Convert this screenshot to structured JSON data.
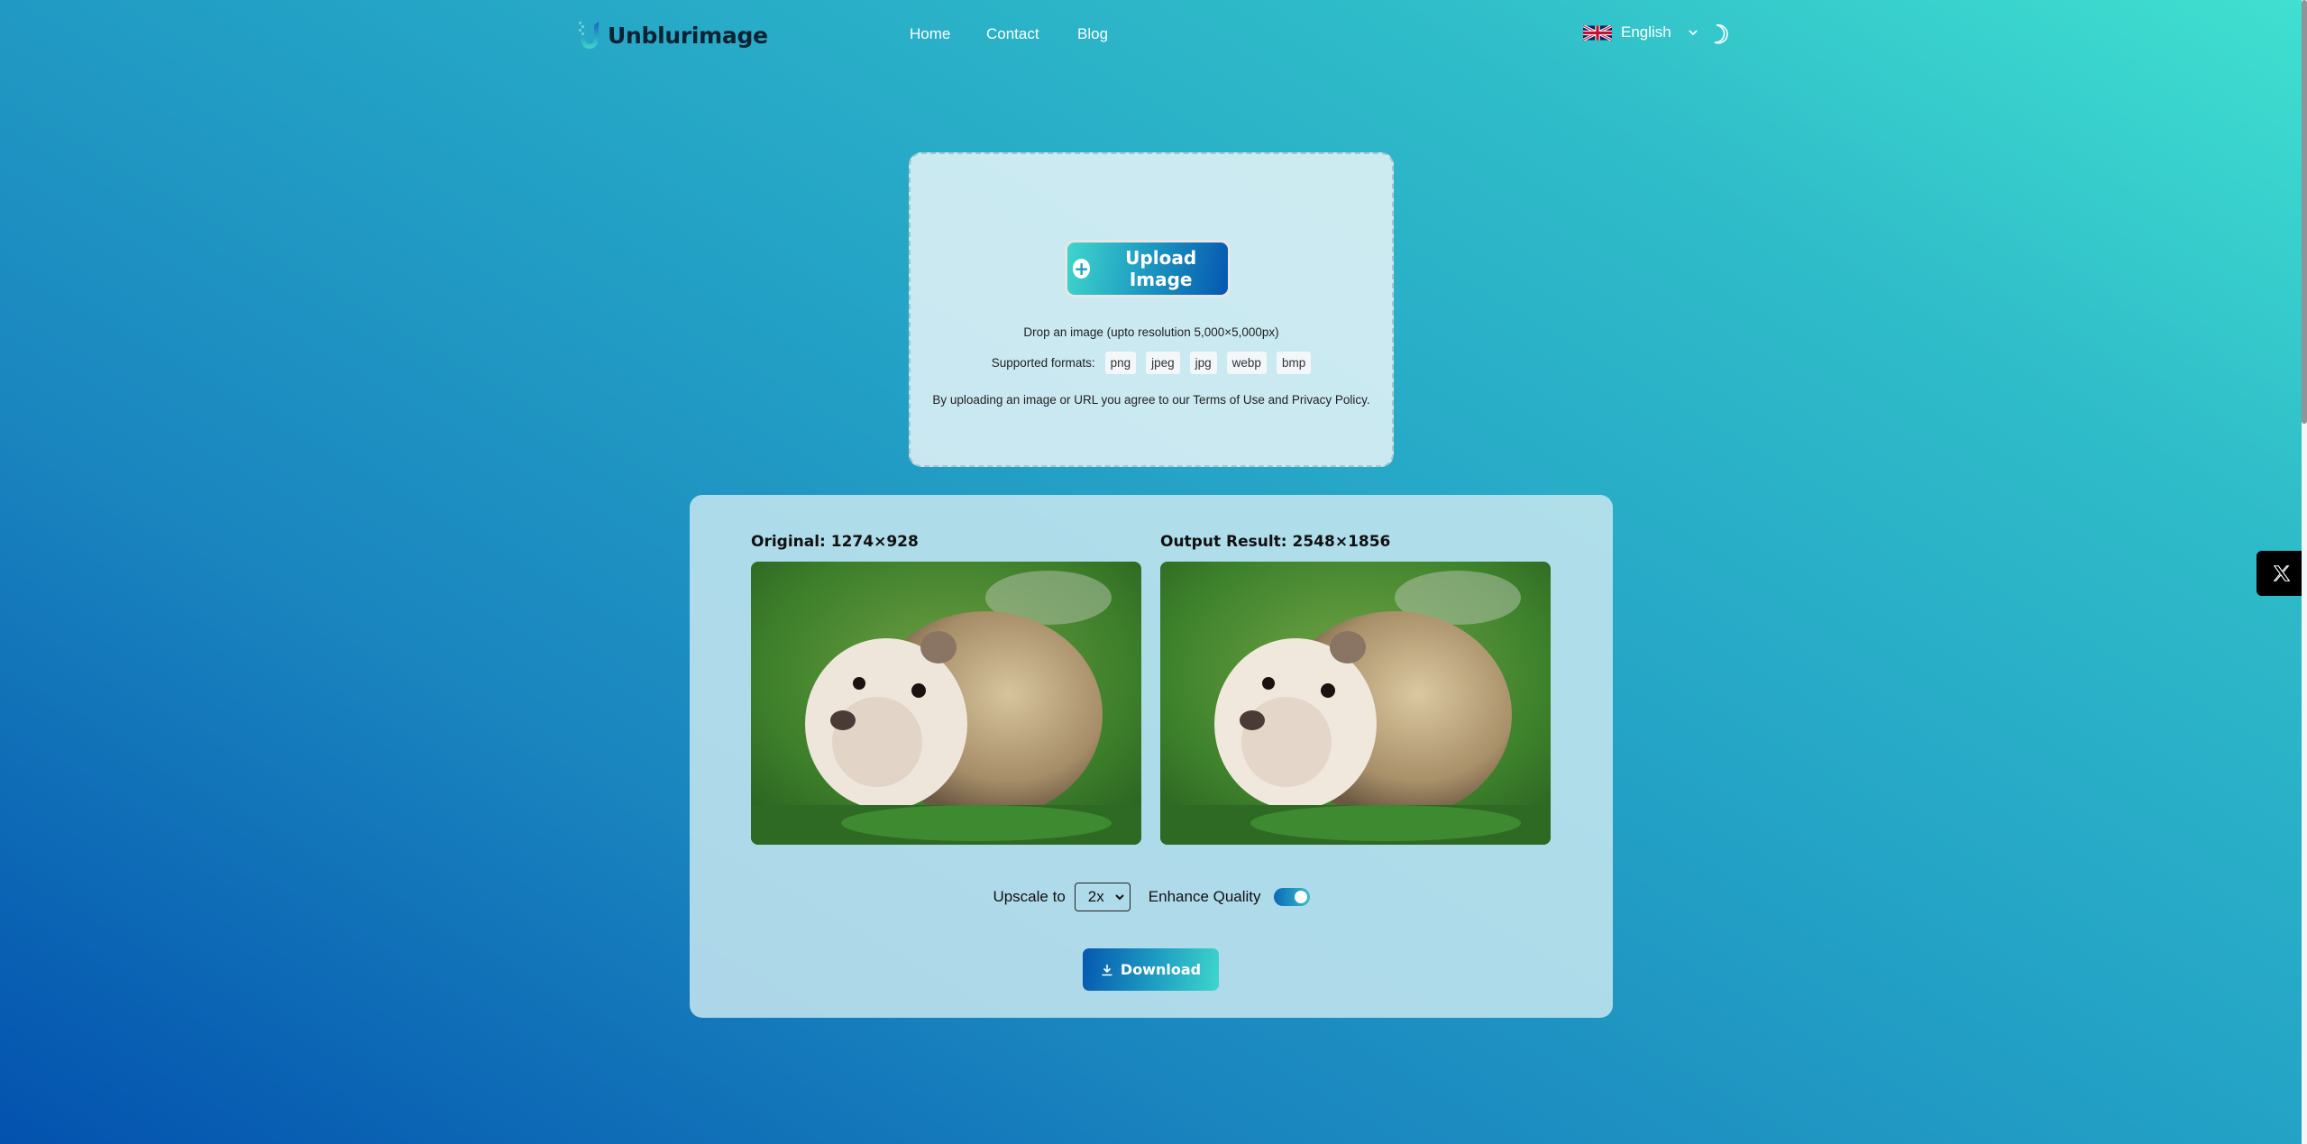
{
  "header": {
    "logo_text": "Unblurimage",
    "nav": [
      {
        "label": "Home"
      },
      {
        "label": "Contact"
      },
      {
        "label": "Blog"
      }
    ],
    "language": {
      "label": "English",
      "flag": "uk-flag-icon"
    },
    "theme_toggle_icon": "moon-icon"
  },
  "upload": {
    "button_label": "Upload Image",
    "button_icon": "plus-circle-icon",
    "drop_text": "Drop an image (upto resolution 5,000×5,000px)",
    "formats_label": "Supported formats:",
    "formats": [
      "png",
      "jpeg",
      "jpg",
      "webp",
      "bmp"
    ],
    "terms_text": "By uploading an image or URL you agree to our Terms of Use and Privacy Policy."
  },
  "result": {
    "original_label": "Original: 1274×928",
    "output_label": "Output Result: 2548×1856",
    "upscale_label": "Upscale to",
    "upscale_value": "2x",
    "enhance_label": "Enhance Quality",
    "enhance_enabled": true,
    "download_label": "Download",
    "download_icon": "download-icon"
  },
  "social": {
    "x_icon": "x-twitter-icon"
  },
  "colors": {
    "bg_start": "#0352ae",
    "bg_end": "#40e0d0",
    "button_dark": "#0557b0",
    "button_light": "#3fd6cc",
    "logo_text": "#0c2234"
  }
}
